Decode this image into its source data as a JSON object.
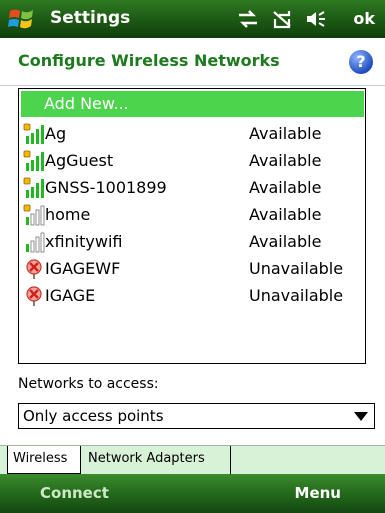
{
  "titlebar": {
    "app_title": "Settings",
    "ok_label": "ok"
  },
  "header": {
    "title": "Configure Wireless Networks",
    "help_icon": "?"
  },
  "networks": {
    "add_new_label": "Add New...",
    "items": [
      {
        "name": "Ag",
        "status": "Available",
        "icon": "wifi-secure-signal-icon"
      },
      {
        "name": "AgGuest",
        "status": "Available",
        "icon": "wifi-secure-signal-icon"
      },
      {
        "name": "GNSS-1001899",
        "status": "Available",
        "icon": "wifi-secure-signal-icon"
      },
      {
        "name": "home",
        "status": "Available",
        "icon": "wifi-secure-weak-signal-icon"
      },
      {
        "name": "xfinitywifi",
        "status": "Available",
        "icon": "wifi-open-weak-signal-icon"
      },
      {
        "name": "IGAGEWF",
        "status": "Unavailable",
        "icon": "wifi-unavailable-icon"
      },
      {
        "name": "IGAGE",
        "status": "Unavailable",
        "icon": "wifi-unavailable-icon"
      }
    ]
  },
  "access": {
    "label": "Networks to access:",
    "selected": "Only access points"
  },
  "tabs": [
    {
      "label": "Wireless"
    },
    {
      "label": "Network Adapters"
    }
  ],
  "softkeys": {
    "left": "Connect",
    "right": "Menu"
  },
  "colors": {
    "titlebar": "#1f5d16",
    "header_text": "#1e7a1e",
    "selection": "#4cd44c"
  }
}
